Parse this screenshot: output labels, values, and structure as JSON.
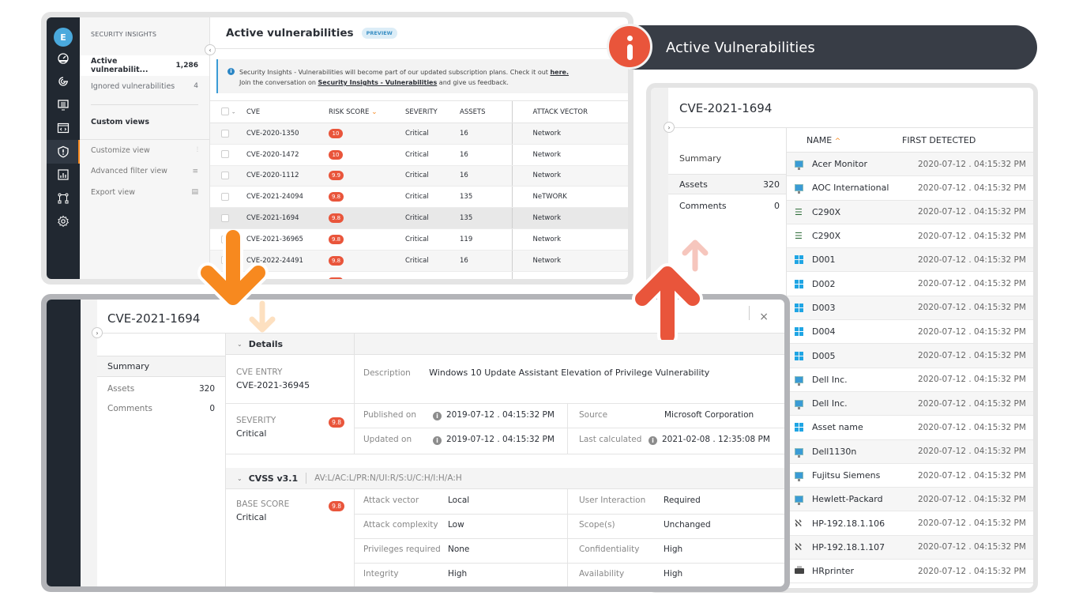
{
  "colors": {
    "accent_orange": "#f7891f",
    "risk_red": "#e9553b",
    "rail_dark": "#212831",
    "info_blue": "#3a9bd5"
  },
  "app": {
    "user_initial": "E",
    "rail_icons": [
      "dashboard-icon",
      "radar-icon",
      "monitor-list-icon",
      "code-window-icon",
      "shield-alert-icon",
      "report-chart-icon",
      "network-topology-icon",
      "settings-gear-icon"
    ],
    "active_rail_icon": "shield-alert-icon"
  },
  "subnav": {
    "header": "SECURITY INSIGHTS",
    "items": [
      {
        "label": "Active vulnerabilit...",
        "count": "1,286",
        "active": true
      },
      {
        "label": "Ignored vulnerabilities",
        "count": "4",
        "active": false
      }
    ],
    "custom_views": "Custom views",
    "tools": [
      {
        "label": "Customize view",
        "icon": "sliders-icon",
        "glyph": "⫶"
      },
      {
        "label": "Advanced filter view",
        "icon": "filter-icon",
        "glyph": "≡"
      },
      {
        "label": "Export view",
        "icon": "export-file-icon",
        "glyph": "▤"
      }
    ]
  },
  "main": {
    "title": "Active vulnerabilities",
    "badge": "PREVIEW",
    "banner": {
      "line1_pre": "Security Insights - Vulnerabilities will become part of our updated subscription plans. Check it out ",
      "line1_link": "here.",
      "line2_pre": "Join the conversation on ",
      "line2_link": "Security Insights - Vulnerabilities",
      "line2_post": " and give us feedback."
    },
    "table": {
      "columns": [
        "CVE",
        "RISK SCORE",
        "SEVERITY",
        "ASSETS",
        "ATTACK VECTOR"
      ],
      "sort_column": "RISK SCORE",
      "rows": [
        {
          "cve": "CVE-2020-1350",
          "score": "10",
          "severity": "Critical",
          "assets": "16",
          "vector": "Network"
        },
        {
          "cve": "CVE-2020-1472",
          "score": "10",
          "severity": "Critical",
          "assets": "16",
          "vector": "Network"
        },
        {
          "cve": "CVE-2020-1112",
          "score": "9.9",
          "severity": "Critical",
          "assets": "16",
          "vector": "Network"
        },
        {
          "cve": "CVE-2021-24094",
          "score": "9.8",
          "severity": "Critical",
          "assets": "135",
          "vector": "NeTWORK"
        },
        {
          "cve": "CVE-2021-1694",
          "score": "9.8",
          "severity": "Critical",
          "assets": "135",
          "vector": "Network",
          "selected": true
        },
        {
          "cve": "CVE-2021-36965",
          "score": "9.8",
          "severity": "Critical",
          "assets": "119",
          "vector": "Network"
        },
        {
          "cve": "CVE-2022-24491",
          "score": "9.8",
          "severity": "Critical",
          "assets": "16",
          "vector": "Network"
        }
      ]
    }
  },
  "heading": {
    "title": "Active Vulnerabilities",
    "icon": "info-icon"
  },
  "assets_panel": {
    "title": "CVE-2021-1694",
    "side": {
      "summary": "Summary",
      "assets_label": "Assets",
      "assets_count": "320",
      "comments_label": "Comments",
      "comments_count": "0"
    },
    "columns": [
      "NAME",
      "FIRST DETECTED"
    ],
    "rows": [
      {
        "type": "monitor",
        "name": "Acer Monitor",
        "detected": "2020-07-12 . 04:15:32 PM"
      },
      {
        "type": "monitor",
        "name": "AOC International",
        "detected": "2020-07-12 . 04:15:32 PM"
      },
      {
        "type": "server",
        "name": "C290X",
        "detected": "2020-07-12 . 04:15:32 PM"
      },
      {
        "type": "server",
        "name": "C290X",
        "detected": "2020-07-12 . 04:15:32 PM"
      },
      {
        "type": "windows",
        "name": "D001",
        "detected": "2020-07-12 . 04:15:32 PM"
      },
      {
        "type": "windows",
        "name": "D002",
        "detected": "2020-07-12 . 04:15:32 PM"
      },
      {
        "type": "windows",
        "name": "D003",
        "detected": "2020-07-12 . 04:15:32 PM"
      },
      {
        "type": "windows",
        "name": "D004",
        "detected": "2020-07-12 . 04:15:32 PM"
      },
      {
        "type": "windows",
        "name": "D005",
        "detected": "2020-07-12 . 04:15:32 PM"
      },
      {
        "type": "monitor",
        "name": "Dell Inc.",
        "detected": "2020-07-12 . 04:15:32 PM"
      },
      {
        "type": "monitor",
        "name": "Dell Inc.",
        "detected": "2020-07-12 . 04:15:32 PM"
      },
      {
        "type": "windows",
        "name": "Asset name",
        "detected": "2020-07-12 . 04:15:32 PM"
      },
      {
        "type": "monitor",
        "name": "Dell1130n",
        "detected": "2020-07-12 . 04:15:32 PM"
      },
      {
        "type": "monitor",
        "name": "Fujitsu Siemens",
        "detected": "2020-07-12 . 04:15:32 PM"
      },
      {
        "type": "monitor",
        "name": "Hewlett-Packard",
        "detected": "2020-07-12 . 04:15:32 PM"
      },
      {
        "type": "network",
        "name": "HP-192.18.1.106",
        "detected": "2020-07-12 . 04:15:32 PM"
      },
      {
        "type": "network",
        "name": "HP-192.18.1.107",
        "detected": "2020-07-12 . 04:15:32 PM"
      },
      {
        "type": "printer",
        "name": "HRprinter",
        "detected": "2020-07-12 . 04:15:32 PM"
      }
    ]
  },
  "details_panel": {
    "title": "CVE-2021-1694",
    "close": "×",
    "side": {
      "summary": "Summary",
      "assets_label": "Assets",
      "assets_count": "320",
      "comments_label": "Comments",
      "comments_count": "0"
    },
    "details_header": "Details",
    "cve_entry_label": "CVE ENTRY",
    "cve_entry_value": "CVE-2021-36945",
    "description_label": "Description",
    "description_value": "Windows 10 Update Assistant Elevation of Privilege Vulnerability",
    "severity_label": "SEVERITY",
    "severity_value": "Critical",
    "severity_score": "9.8",
    "published_label": "Published on",
    "published_value": "2019-07-12 . 04:15:32 PM",
    "updated_label": "Updated on",
    "updated_value": "2019-07-12 . 04:15:32 PM",
    "source_label": "Source",
    "source_value": "Microsoft Corporation",
    "last_calc_label": "Last calculated",
    "last_calc_value": "2021-02-08 . 12:35:08 PM",
    "cvss_header": "CVSS v3.1",
    "cvss_vector": "AV:L/AC:L/PR:N/UI:R/S:U/C:H/I:H/A:H",
    "base_score_label": "BASE SCORE",
    "base_score_value": "Critical",
    "base_score": "9.8",
    "metrics_left": [
      {
        "label": "Attack vector",
        "value": "Local"
      },
      {
        "label": "Attack complexity",
        "value": "Low"
      },
      {
        "label": "Privileges required",
        "value": "None"
      },
      {
        "label": "Integrity",
        "value": "High"
      }
    ],
    "metrics_right": [
      {
        "label": "User Interaction",
        "value": "Required"
      },
      {
        "label": "Scope(s)",
        "value": "Unchanged"
      },
      {
        "label": "Confidentiality",
        "value": "High"
      },
      {
        "label": "Availability",
        "value": "High"
      }
    ]
  }
}
